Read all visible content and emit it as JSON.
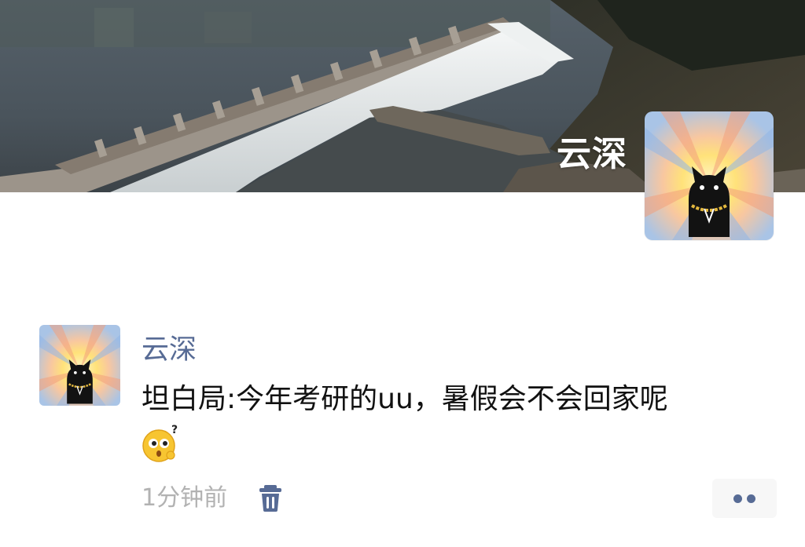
{
  "profile": {
    "name": "云深",
    "cover_image": "river-weir-photo",
    "avatar_image": "black-cat-sunburst-avatar"
  },
  "post": {
    "author": "云深",
    "text": "坦白局:今年考研的uu，暑假会不会回家呢",
    "emoji": "thinking-question-emoji",
    "time": "1分钟前",
    "delete_icon": "trash-icon",
    "more_icon": "more-dots-icon"
  },
  "colors": {
    "author_link": "#576b95",
    "time_text": "#b2b2b2",
    "body_text": "#111111",
    "more_button_bg": "#f7f7f7"
  }
}
